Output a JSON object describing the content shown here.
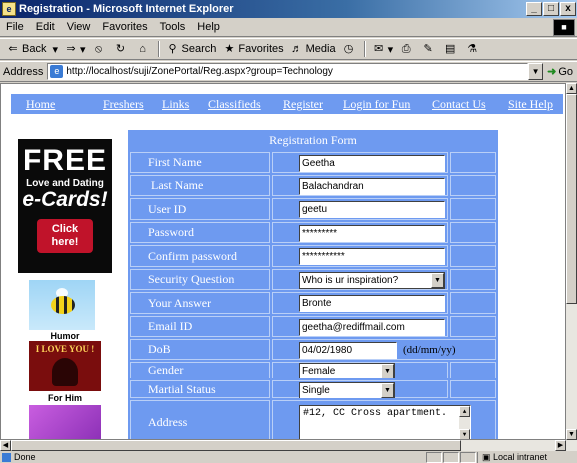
{
  "window": {
    "title": "Registration - Microsoft Internet Explorer",
    "minimize": "_",
    "maximize": "□",
    "close": "x"
  },
  "menu": [
    "File",
    "Edit",
    "View",
    "Favorites",
    "Tools",
    "Help"
  ],
  "toolbar": {
    "back": "Back",
    "search": "Search",
    "favorites": "Favorites",
    "media": "Media"
  },
  "address": {
    "label": "Address",
    "url": "http://localhost/suji/ZonePortal/Reg.aspx?group=Technology",
    "go": "Go"
  },
  "nav": [
    "Home",
    "Freshers",
    "Links",
    "Classifieds",
    "Register",
    "Login for Fun",
    "Contact Us",
    "Site Help"
  ],
  "ads": {
    "free": "FREE",
    "love": "Love and Dating",
    "ecards": "e-Cards!",
    "click": "Click here!",
    "humor": "Humor",
    "love_you": "I LOVE YOU !",
    "for_him": "For Him"
  },
  "form": {
    "header": "Registration Form",
    "first_name_label": "First Name",
    "first_name": "Geetha",
    "last_name_label": "Last Name",
    "last_name": "Balachandran",
    "user_id_label": "User ID",
    "user_id": "geetu",
    "password_label": "Password",
    "password": "*********",
    "confirm_label": "Confirm password",
    "confirm": "***********",
    "security_label": "Security Question",
    "security": "Who is ur inspiration?",
    "answer_label": "Your Answer",
    "answer": "Bronte",
    "email_label": "Email ID",
    "email": "geetha@rediffmail.com",
    "dob_label": "DoB",
    "dob": "04/02/1980",
    "dob_hint": "(dd/mm/yy)",
    "gender_label": "Gender",
    "gender": "Female",
    "marital_label": "Martial Status",
    "marital": "Single",
    "address_label": "Address",
    "address": "#12, CC Cross apartment."
  },
  "status": {
    "text": "Done",
    "zone": "Local intranet"
  }
}
